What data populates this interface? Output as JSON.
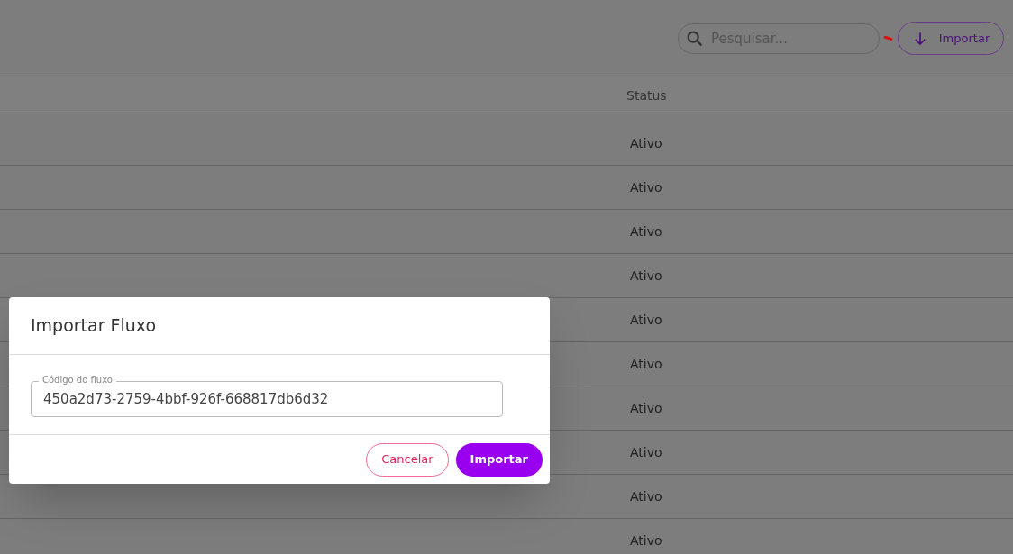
{
  "toolbar": {
    "search": {
      "placeholder": "Pesquisar..."
    },
    "import_button": "Importar"
  },
  "table": {
    "columns": [
      "Status"
    ],
    "rows": [
      {
        "status": "Ativo"
      },
      {
        "status": "Ativo"
      },
      {
        "status": "Ativo"
      },
      {
        "status": "Ativo"
      },
      {
        "status": "Ativo"
      },
      {
        "status": "Ativo"
      },
      {
        "status": "Ativo"
      },
      {
        "status": "Ativo"
      },
      {
        "status": "Ativo"
      },
      {
        "status": "Ativo"
      }
    ]
  },
  "dialog": {
    "title": "Importar Fluxo",
    "field": {
      "label": "Código do fluxo",
      "value": "450a2d73-2759-4bbf-926f-668817db6d32"
    },
    "buttons": {
      "cancel": "Cancelar",
      "confirm": "Importar"
    }
  }
}
